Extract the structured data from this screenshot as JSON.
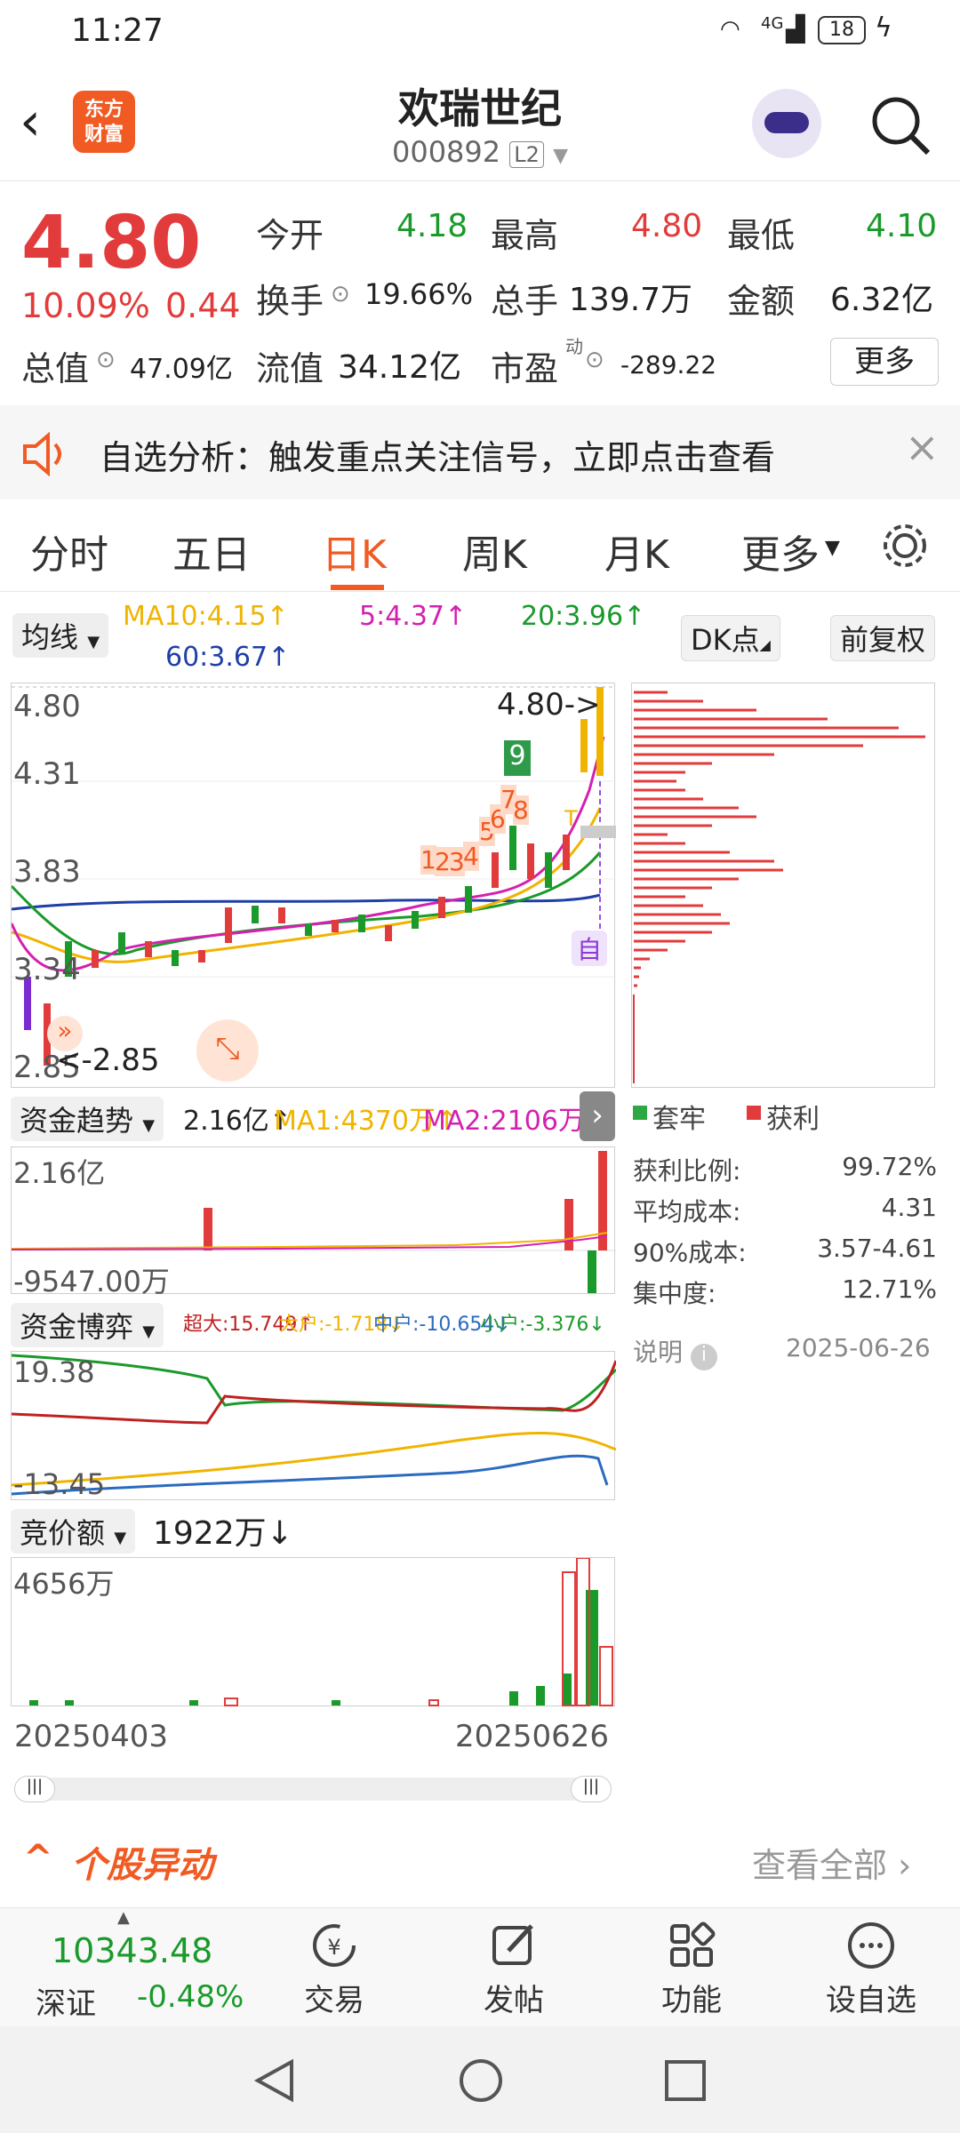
{
  "status": {
    "time": "11:27",
    "network": "4G",
    "battery": "18"
  },
  "header": {
    "title": "欢瑞世纪",
    "code": "000892",
    "badge": "L2",
    "logo_lines": [
      "东方",
      "财富"
    ]
  },
  "quote": {
    "price": "4.80",
    "pct": "10.09%",
    "chg": "0.44",
    "open_label": "今开",
    "open": "4.18",
    "high_label": "最高",
    "high": "4.80",
    "low_label": "最低",
    "low": "4.10",
    "turnover_label": "换手",
    "turnover": "19.66%",
    "vol_label": "总手",
    "vol": "139.7万",
    "amount_label": "金额",
    "amount": "6.32亿",
    "mktcap_label": "总值",
    "mktcap": "47.09亿",
    "float_label": "流值",
    "float": "34.12亿",
    "pe_label": "市盈",
    "pe_sup": "动",
    "pe": "-289.22",
    "more": "更多"
  },
  "banner": {
    "text": "自选分析：触发重点关注信号，立即点击查看"
  },
  "tabs": [
    "分时",
    "五日",
    "日K",
    "周K",
    "月K",
    "更多"
  ],
  "active_tab": "日K",
  "ma": {
    "selector": "均线",
    "ma10": "MA10:4.15↑",
    "ma5": "5:4.37↑",
    "ma20": "20:3.96↑",
    "ma60": "60:3.67↑",
    "dk": "DK点",
    "fq": "前复权"
  },
  "kline": {
    "y_labels": [
      "4.80",
      "4.31",
      "3.83",
      "3.34",
      "2.85"
    ],
    "last_label": "4.80->",
    "low_label": "<-2.85",
    "auto": "自",
    "t_marker": "T",
    "signals": [
      "9",
      "1",
      "2",
      "3",
      "4",
      "5",
      "6",
      "7",
      "8"
    ]
  },
  "fund_trend": {
    "selector": "资金趋势",
    "value": "2.16亿↑",
    "ma1": "MA1:4370万↑",
    "ma2": "MA2:2106万↑",
    "top": "2.16亿",
    "bottom": "-9547.00万"
  },
  "fund_game": {
    "selector": "资金博弈",
    "super": "超大:15.749↑",
    "large": "大户:-1.718↓",
    "mid": "中户:-10.654↓",
    "small": "小户:-3.376↓",
    "top": "19.38",
    "bottom": "-13.45"
  },
  "auction": {
    "selector": "竞价额",
    "value": "1922万↓",
    "top": "4656万",
    "date_start": "20250403",
    "date_end": "20250626"
  },
  "chip": {
    "legend_trap": "套牢",
    "legend_profit": "获利",
    "rows": [
      {
        "label": "获利比例:",
        "value": "99.72%"
      },
      {
        "label": "平均成本:",
        "value": "4.31"
      },
      {
        "label": "90%成本:",
        "value": "3.57-4.61"
      },
      {
        "label": "集中度:",
        "value": "12.71%"
      }
    ],
    "note": "说明",
    "date": "2025-06-26"
  },
  "movement": {
    "title": "个股异动",
    "link": "查看全部"
  },
  "index": {
    "value": "10343.48",
    "name": "深证",
    "pct": "-0.48%"
  },
  "nav": [
    "交易",
    "发帖",
    "功能",
    "设自选"
  ],
  "colors": {
    "up": "#e23b3b",
    "down": "#1a9a2a",
    "accent": "#f15a22",
    "ma10": "#f0b400",
    "ma5": "#d420b0",
    "ma20": "#1a9a2a",
    "ma60": "#1f3fa8"
  }
}
